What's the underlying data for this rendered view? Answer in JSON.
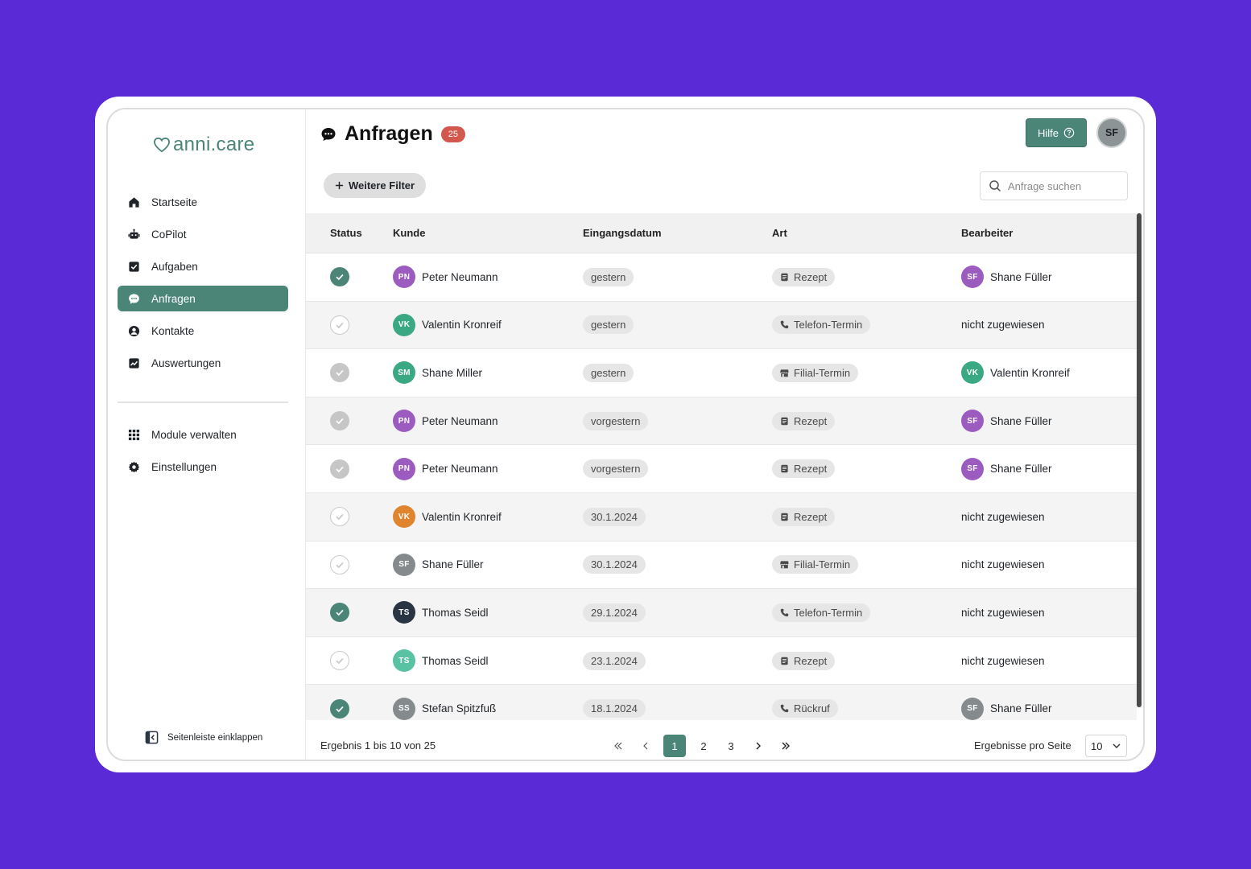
{
  "brand": {
    "name": "anni.care",
    "color": "#4a8578"
  },
  "sidebar": {
    "items": [
      {
        "label": "Startseite",
        "icon": "home-icon"
      },
      {
        "label": "CoPilot",
        "icon": "robot-icon"
      },
      {
        "label": "Aufgaben",
        "icon": "checkbox-icon"
      },
      {
        "label": "Anfragen",
        "icon": "chat-icon",
        "active": true
      },
      {
        "label": "Kontakte",
        "icon": "person-icon"
      },
      {
        "label": "Auswertungen",
        "icon": "chart-icon"
      }
    ],
    "items2": [
      {
        "label": "Module verwalten",
        "icon": "grid-icon"
      },
      {
        "label": "Einstellungen",
        "icon": "gear-icon"
      }
    ],
    "collapse_label": "Seitenleiste einklappen"
  },
  "header": {
    "title": "Anfragen",
    "count": "25",
    "help_label": "Hilfe",
    "user_initials": "SF"
  },
  "toolbar": {
    "filter_label": "Weitere Filter",
    "search_placeholder": "Anfrage suchen"
  },
  "table": {
    "columns": {
      "status": "Status",
      "kunde": "Kunde",
      "datum": "Eingangsdatum",
      "art": "Art",
      "bearbeiter": "Bearbeiter"
    },
    "rows": [
      {
        "status": "done",
        "initials": "PN",
        "avatar": "#9b5bbf",
        "name": "Peter Neumann",
        "date": "gestern",
        "art": "Rezept",
        "art_icon": "document-icon",
        "assignee": "Shane Füller",
        "assignee_initials": "SF",
        "assignee_avatar": "#9b5bbf"
      },
      {
        "status": "open",
        "initials": "VK",
        "avatar": "#3aa883",
        "name": "Valentin Kronreif",
        "date": "gestern",
        "art": "Telefon-Termin",
        "art_icon": "phone-icon",
        "assignee": "nicht zugewiesen",
        "assignee_initials": "",
        "assignee_avatar": ""
      },
      {
        "status": "grey",
        "initials": "SM",
        "avatar": "#3aa883",
        "name": "Shane Miller",
        "date": "gestern",
        "art": "Filial-Termin",
        "art_icon": "store-icon",
        "assignee": "Valentin Kronreif",
        "assignee_initials": "VK",
        "assignee_avatar": "#3aa883"
      },
      {
        "status": "grey",
        "initials": "PN",
        "avatar": "#9b5bbf",
        "name": "Peter Neumann",
        "date": "vorgestern",
        "art": "Rezept",
        "art_icon": "document-icon",
        "assignee": "Shane Füller",
        "assignee_initials": "SF",
        "assignee_avatar": "#9b5bbf"
      },
      {
        "status": "grey",
        "initials": "PN",
        "avatar": "#9b5bbf",
        "name": "Peter Neumann",
        "date": "vorgestern",
        "art": "Rezept",
        "art_icon": "document-icon",
        "assignee": "Shane Füller",
        "assignee_initials": "SF",
        "assignee_avatar": "#9b5bbf"
      },
      {
        "status": "open",
        "initials": "VK",
        "avatar": "#e0852e",
        "name": "Valentin Kronreif",
        "date": "30.1.2024",
        "art": "Rezept",
        "art_icon": "document-icon",
        "assignee": "nicht zugewiesen",
        "assignee_initials": "",
        "assignee_avatar": ""
      },
      {
        "status": "open",
        "initials": "SF",
        "avatar": "#858b8d",
        "name": "Shane Füller",
        "date": "30.1.2024",
        "art": "Filial-Termin",
        "art_icon": "store-icon",
        "assignee": "nicht zugewiesen",
        "assignee_initials": "",
        "assignee_avatar": ""
      },
      {
        "status": "done",
        "initials": "TS",
        "avatar": "#2a3543",
        "name": "Thomas Seidl",
        "date": "29.1.2024",
        "art": "Telefon-Termin",
        "art_icon": "phone-icon",
        "assignee": "nicht zugewiesen",
        "assignee_initials": "",
        "assignee_avatar": ""
      },
      {
        "status": "open",
        "initials": "TS",
        "avatar": "#58c2a2",
        "name": "Thomas Seidl",
        "date": "23.1.2024",
        "art": "Rezept",
        "art_icon": "document-icon",
        "assignee": "nicht zugewiesen",
        "assignee_initials": "",
        "assignee_avatar": ""
      },
      {
        "status": "done",
        "initials": "SS",
        "avatar": "#858b8d",
        "name": "Stefan Spitzfuß",
        "date": "18.1.2024",
        "art": "Rückruf",
        "art_icon": "phone-icon",
        "assignee": "Shane Füller",
        "assignee_initials": "SF",
        "assignee_avatar": "#858b8d"
      }
    ]
  },
  "footer": {
    "result_text": "Ergebnis 1 bis 10 von 25",
    "pages": [
      "1",
      "2",
      "3"
    ],
    "current_page": "1",
    "per_page_label": "Ergebnisse pro Seite",
    "per_page_value": "10"
  }
}
